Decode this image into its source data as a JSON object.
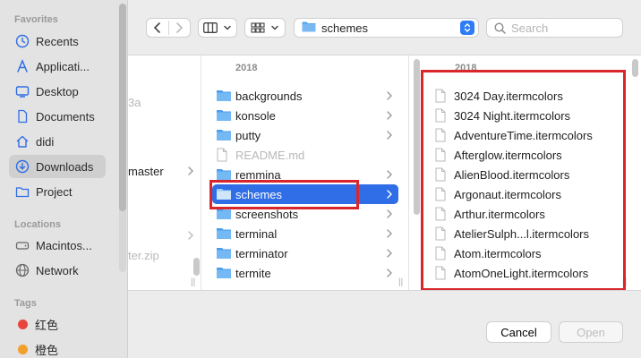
{
  "sidebar": {
    "sections": {
      "favorites": "Favorites",
      "locations": "Locations",
      "tags": "Tags"
    },
    "favorites": [
      {
        "label": "Recents",
        "icon": "clock-icon"
      },
      {
        "label": "Applicati...",
        "icon": "applications-icon"
      },
      {
        "label": "Desktop",
        "icon": "desktop-icon"
      },
      {
        "label": "Documents",
        "icon": "document-icon"
      },
      {
        "label": "didi",
        "icon": "home-icon"
      },
      {
        "label": "Downloads",
        "icon": "download-icon",
        "selected": true
      },
      {
        "label": "Project",
        "icon": "folder-icon"
      }
    ],
    "locations": [
      {
        "label": "Macintos...",
        "icon": "disk-icon"
      },
      {
        "label": "Network",
        "icon": "network-icon"
      }
    ],
    "tags": [
      {
        "label": "红色",
        "color": "#e8453c"
      },
      {
        "label": "橙色",
        "color": "#f2a02c"
      }
    ]
  },
  "toolbar": {
    "path_label": "schemes",
    "search_placeholder": "Search",
    "back_icon": "chevron-left-icon",
    "forward_icon": "chevron-right-icon",
    "view_icon": "columns-view-icon",
    "group_icon": "grid-group-icon"
  },
  "browser": {
    "col1": {
      "items": [
        {
          "label": "3a",
          "faded": true
        },
        {
          "label": "master",
          "has_children": true
        },
        {
          "label": "ter.zip",
          "faded": true
        }
      ]
    },
    "col2": {
      "header": "2018",
      "items": [
        {
          "label": "backgrounds",
          "type": "folder"
        },
        {
          "label": "konsole",
          "type": "folder"
        },
        {
          "label": "putty",
          "type": "folder"
        },
        {
          "label": "README.md",
          "type": "file",
          "faded": true
        },
        {
          "label": "remmina",
          "type": "folder"
        },
        {
          "label": "schemes",
          "type": "folder",
          "selected": true
        },
        {
          "label": "screenshots",
          "type": "folder"
        },
        {
          "label": "terminal",
          "type": "folder"
        },
        {
          "label": "terminator",
          "type": "folder"
        },
        {
          "label": "termite",
          "type": "folder"
        }
      ]
    },
    "col3": {
      "header": "2018",
      "items": [
        "3024 Day.itermcolors",
        "3024 Night.itermcolors",
        "AdventureTime.itermcolors",
        "Afterglow.itermcolors",
        "AlienBlood.itermcolors",
        "Argonaut.itermcolors",
        "Arthur.itermcolors",
        "AtelierSulph...l.itermcolors",
        "Atom.itermcolors",
        "AtomOneLight.itermcolors"
      ]
    }
  },
  "buttons": {
    "cancel": "Cancel",
    "open": "Open"
  },
  "colors": {
    "accent": "#2f6ee6",
    "annotation_red": "#d9262b"
  }
}
